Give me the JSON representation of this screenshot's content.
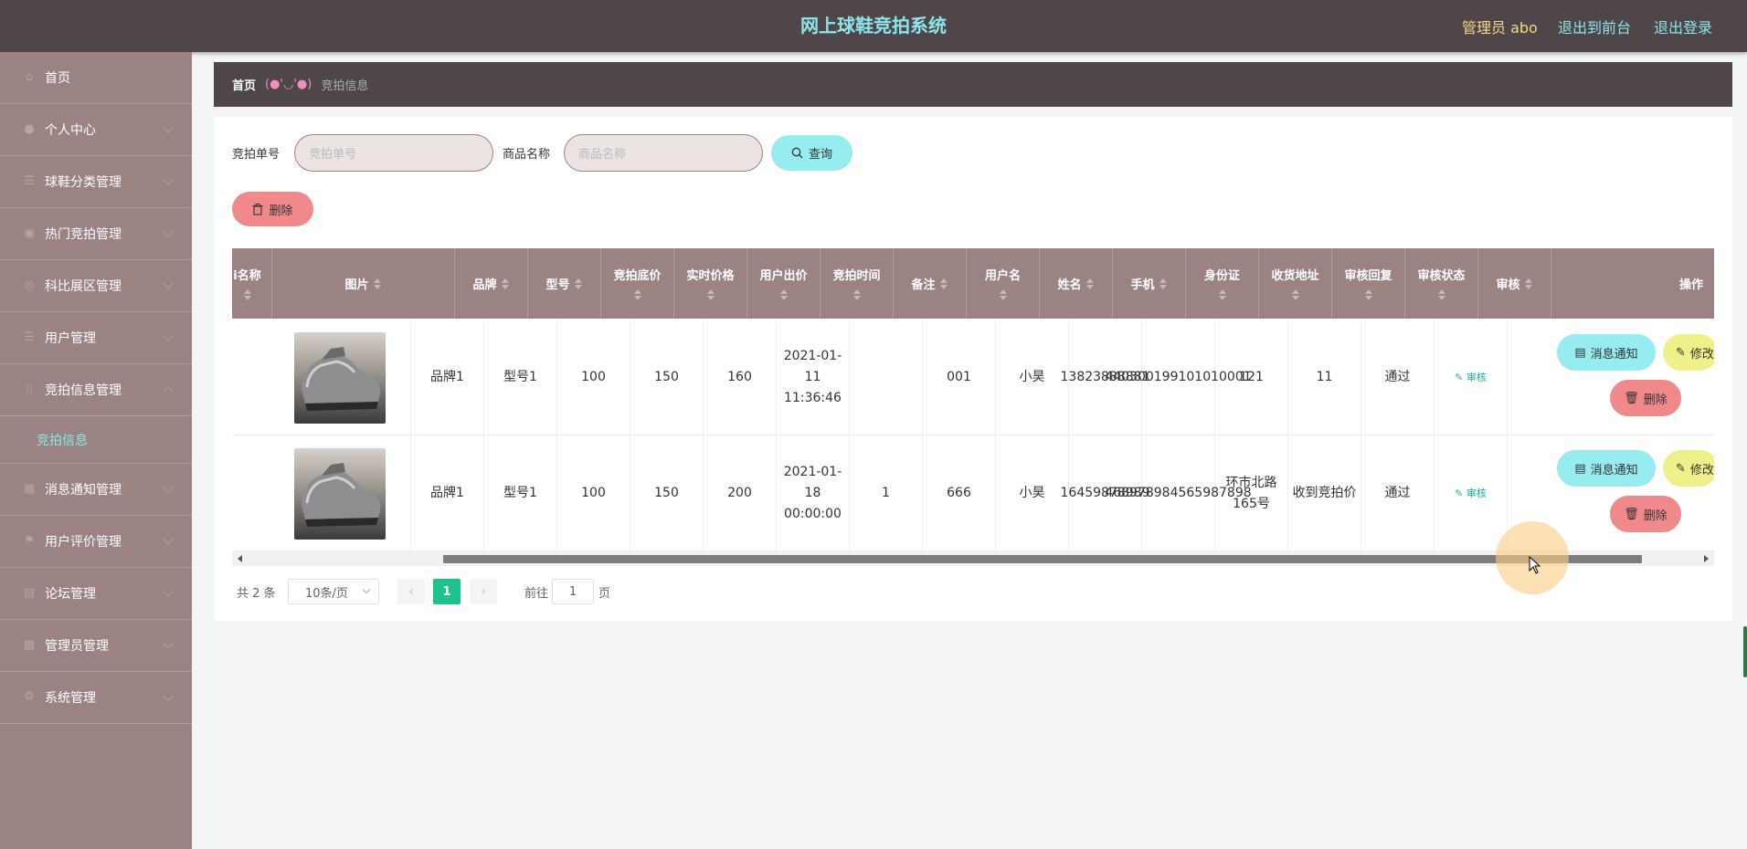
{
  "header": {
    "title": "网上球鞋竞拍系统",
    "admin": "管理员 abo",
    "to_front": "退出到前台",
    "logout": "退出登录"
  },
  "sidebar": {
    "items": [
      {
        "label": "首页",
        "icon": "home-icon"
      },
      {
        "label": "个人中心",
        "icon": "user-icon"
      },
      {
        "label": "球鞋分类管理",
        "icon": "list-icon"
      },
      {
        "label": "热门竞拍管理",
        "icon": "fire-icon"
      },
      {
        "label": "科比展区管理",
        "icon": "star-icon"
      },
      {
        "label": "用户管理",
        "icon": "users-icon"
      },
      {
        "label": "竞拍信息管理",
        "icon": "doc-icon",
        "sub": "竞拍信息"
      },
      {
        "label": "消息通知管理",
        "icon": "bell-icon"
      },
      {
        "label": "用户评价管理",
        "icon": "flag-icon"
      },
      {
        "label": "论坛管理",
        "icon": "chat-icon"
      },
      {
        "label": "管理员管理",
        "icon": "shield-icon"
      },
      {
        "label": "系统管理",
        "icon": "gear-icon"
      }
    ]
  },
  "breadcrumb": {
    "home": "首页",
    "face": "(●'◡'●)",
    "current": "竞拍信息"
  },
  "search": {
    "label1": "竞拍单号",
    "placeholder1": "竞拍单号",
    "label2": "商品名称",
    "placeholder2": "商品名称",
    "query": "查询"
  },
  "toolbar": {
    "delete": "删除"
  },
  "table": {
    "columns": [
      "i名称",
      "图片",
      "品牌",
      "型号",
      "竞拍底价",
      "实时价格",
      "用户出价",
      "竞拍时间",
      "备注",
      "用户名",
      "姓名",
      "手机",
      "身份证",
      "收货地址",
      "审核回复",
      "审核状态",
      "审核",
      "操作"
    ],
    "rows": [
      {
        "brand": "品牌1",
        "model": "型号1",
        "base_price": "100",
        "live_price": "150",
        "bid": "160",
        "time": "2021-01-11 11:36:46",
        "remark": "",
        "username": "001",
        "name": "小昊",
        "phone": "13823888881",
        "id_card": "440300199101010001",
        "address": "121",
        "review_reply": "11",
        "review_status": "通过",
        "review": "审核"
      },
      {
        "brand": "品牌1",
        "model": "型号1",
        "base_price": "100",
        "live_price": "150",
        "bid": "200",
        "time": "2021-01-18 00:00:00",
        "remark": "1",
        "username": "666",
        "name": "小昊",
        "phone": "16459878989",
        "id_card": "468978984565987898",
        "address": "环市北路165号",
        "review_reply": "收到竞拍价",
        "review_status": "通过",
        "review": "审核"
      }
    ],
    "actions": {
      "notify": "消息通知",
      "edit": "修改",
      "delete": "删除"
    }
  },
  "pagination": {
    "total": "共 2 条",
    "page_size": "10条/页",
    "current": "1",
    "goto_label": "前往",
    "goto_value": "1",
    "page_suffix": "页"
  },
  "colors": {
    "accent": "#8ee6ea",
    "sidebar": "#9b8283",
    "header": "#4e4648",
    "danger": "#f0898b",
    "success": "#1fc28c"
  }
}
